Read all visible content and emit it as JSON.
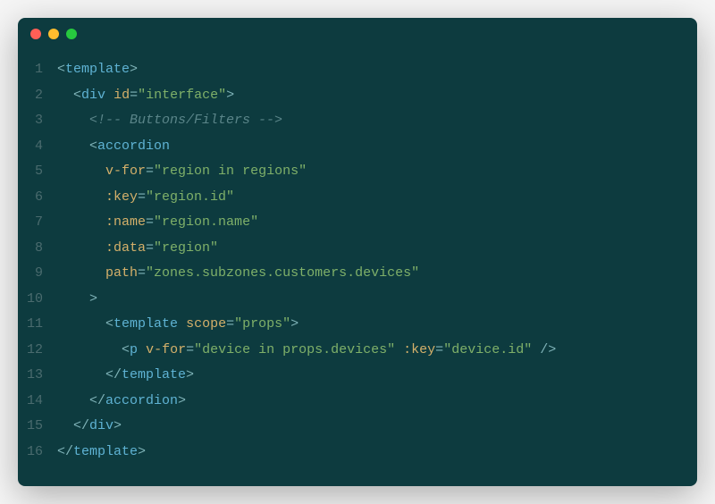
{
  "lines": [
    {
      "n": "1",
      "tokens": [
        [
          "punct",
          "<"
        ],
        [
          "tag",
          "template"
        ],
        [
          "punct",
          ">"
        ]
      ]
    },
    {
      "n": "2",
      "tokens": [
        [
          "",
          "  "
        ],
        [
          "punct",
          "<"
        ],
        [
          "tag",
          "div"
        ],
        [
          "",
          " "
        ],
        [
          "attr",
          "id"
        ],
        [
          "punct",
          "="
        ],
        [
          "str",
          "\"interface\""
        ],
        [
          "punct",
          ">"
        ]
      ]
    },
    {
      "n": "3",
      "tokens": [
        [
          "",
          "    "
        ],
        [
          "comment",
          "<!-- Buttons/Filters -->"
        ]
      ]
    },
    {
      "n": "4",
      "tokens": [
        [
          "",
          "    "
        ],
        [
          "punct",
          "<"
        ],
        [
          "tag",
          "accordion"
        ]
      ]
    },
    {
      "n": "5",
      "tokens": [
        [
          "",
          "      "
        ],
        [
          "attr",
          "v-for"
        ],
        [
          "punct",
          "="
        ],
        [
          "str",
          "\"region in regions\""
        ]
      ]
    },
    {
      "n": "6",
      "tokens": [
        [
          "",
          "      "
        ],
        [
          "attr",
          ":key"
        ],
        [
          "punct",
          "="
        ],
        [
          "str",
          "\"region.id\""
        ]
      ]
    },
    {
      "n": "7",
      "tokens": [
        [
          "",
          "      "
        ],
        [
          "attr",
          ":name"
        ],
        [
          "punct",
          "="
        ],
        [
          "str",
          "\"region.name\""
        ]
      ]
    },
    {
      "n": "8",
      "tokens": [
        [
          "",
          "      "
        ],
        [
          "attr",
          ":data"
        ],
        [
          "punct",
          "="
        ],
        [
          "str",
          "\"region\""
        ]
      ]
    },
    {
      "n": "9",
      "tokens": [
        [
          "",
          "      "
        ],
        [
          "attr",
          "path"
        ],
        [
          "punct",
          "="
        ],
        [
          "str",
          "\"zones.subzones.customers.devices\""
        ]
      ]
    },
    {
      "n": "10",
      "tokens": [
        [
          "",
          "    "
        ],
        [
          "punct",
          ">"
        ]
      ]
    },
    {
      "n": "11",
      "tokens": [
        [
          "",
          "      "
        ],
        [
          "punct",
          "<"
        ],
        [
          "tag",
          "template"
        ],
        [
          "",
          " "
        ],
        [
          "attr",
          "scope"
        ],
        [
          "punct",
          "="
        ],
        [
          "str",
          "\"props\""
        ],
        [
          "punct",
          ">"
        ]
      ]
    },
    {
      "n": "12",
      "tokens": [
        [
          "",
          "        "
        ],
        [
          "punct",
          "<"
        ],
        [
          "tag",
          "p"
        ],
        [
          "",
          " "
        ],
        [
          "attr",
          "v-for"
        ],
        [
          "punct",
          "="
        ],
        [
          "str",
          "\"device in props.devices\""
        ],
        [
          "",
          " "
        ],
        [
          "attr",
          ":key"
        ],
        [
          "punct",
          "="
        ],
        [
          "str",
          "\"device.id\""
        ],
        [
          "",
          " "
        ],
        [
          "punct",
          "/>"
        ]
      ]
    },
    {
      "n": "13",
      "tokens": [
        [
          "",
          "      "
        ],
        [
          "punct",
          "</"
        ],
        [
          "tag",
          "template"
        ],
        [
          "punct",
          ">"
        ]
      ]
    },
    {
      "n": "14",
      "tokens": [
        [
          "",
          "    "
        ],
        [
          "punct",
          "</"
        ],
        [
          "tag",
          "accordion"
        ],
        [
          "punct",
          ">"
        ]
      ]
    },
    {
      "n": "15",
      "tokens": [
        [
          "",
          "  "
        ],
        [
          "punct",
          "</"
        ],
        [
          "tag",
          "div"
        ],
        [
          "punct",
          ">"
        ]
      ]
    },
    {
      "n": "16",
      "tokens": [
        [
          "punct",
          "</"
        ],
        [
          "tag",
          "template"
        ],
        [
          "punct",
          ">"
        ]
      ]
    }
  ]
}
